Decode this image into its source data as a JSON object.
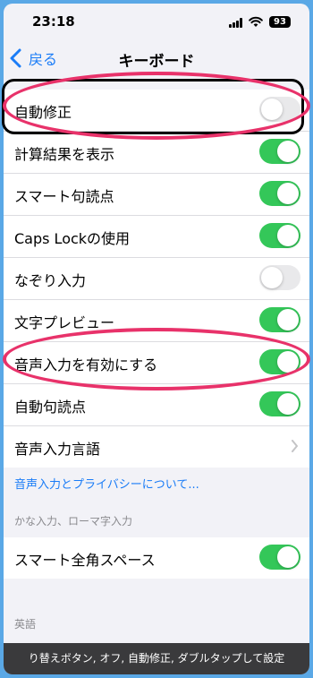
{
  "status_bar": {
    "time": "23:18",
    "battery": "93"
  },
  "nav": {
    "back_label": "戻る",
    "title": "キーボード"
  },
  "settings": [
    {
      "label": "自動修正",
      "state": "off"
    },
    {
      "label": "計算結果を表示",
      "state": "on"
    },
    {
      "label": "スマート句読点",
      "state": "on"
    },
    {
      "label": "Caps Lockの使用",
      "state": "on"
    },
    {
      "label": "なぞり入力",
      "state": "off"
    },
    {
      "label": "文字プレビュー",
      "state": "on"
    },
    {
      "label": "音声入力を有効にする",
      "state": "on"
    },
    {
      "label": "自動句読点",
      "state": "on"
    },
    {
      "label": "音声入力言語"
    }
  ],
  "privacy_link": "音声入力とプライバシーについて...",
  "kana_section": {
    "header": "かな入力、ローマ字入力",
    "item": {
      "label": "スマート全角スペース",
      "state": "on"
    }
  },
  "english_section": {
    "header": "英語"
  },
  "caption": "り替えボタン, オフ, 自動修正, ダブルタップして設定",
  "colors": {
    "accent": "#1a7cf7",
    "toggle_on": "#34c759",
    "highlight": "#e8326a"
  }
}
